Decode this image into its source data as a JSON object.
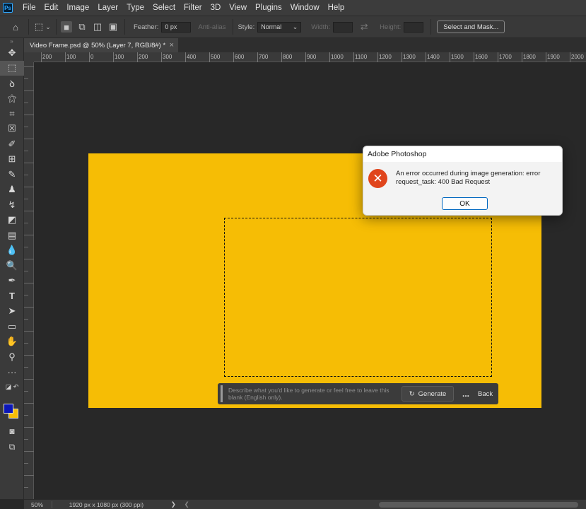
{
  "app": {
    "logo": "Ps"
  },
  "menu": [
    "File",
    "Edit",
    "Image",
    "Layer",
    "Type",
    "Select",
    "Filter",
    "3D",
    "View",
    "Plugins",
    "Window",
    "Help"
  ],
  "options": {
    "feather_label": "Feather:",
    "feather_value": "0 px",
    "antialias_label": "Anti-alias",
    "style_label": "Style:",
    "style_value": "Normal",
    "width_label": "Width:",
    "height_label": "Height:",
    "select_mask_label": "Select and Mask..."
  },
  "document_tab": {
    "title": "Video Frame.psd @ 50% (Layer 7, RGB/8#) *",
    "close": "×"
  },
  "ruler_labels": [
    "200",
    "100",
    "0",
    "100",
    "200",
    "300",
    "400",
    "500",
    "600",
    "700",
    "800",
    "900",
    "1000",
    "1100",
    "1200",
    "1300",
    "1400",
    "1500",
    "1600",
    "1700",
    "1800",
    "1900",
    "2000"
  ],
  "generate_bar": {
    "placeholder": "Describe what you'd like to generate or feel free to leave this blank (English only).",
    "generate_label": "Generate",
    "more_label": "...",
    "back_label": "Back"
  },
  "dialog": {
    "title": "Adobe Photoshop",
    "message": "An error occurred during image generation: error request_task: 400 Bad Request",
    "ok_label": "OK"
  },
  "status": {
    "zoom": "50%",
    "doc_info": "1920 px x 1080 px (300 ppi)",
    "arrow": "❯",
    "left_arrow": "❮"
  },
  "colors": {
    "foreground": "#0c17b8",
    "background": "#f6bd05",
    "artboard": "#f6bd05",
    "error": "#e0451c"
  }
}
